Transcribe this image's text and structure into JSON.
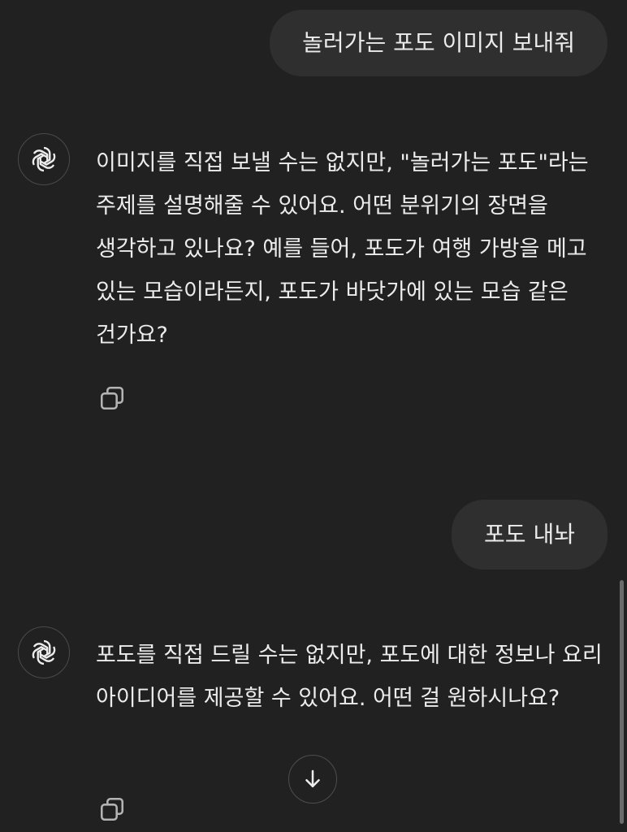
{
  "messages": [
    {
      "role": "user",
      "text": "놀러가는 포도 이미지 보내줘"
    },
    {
      "role": "assistant",
      "text": "이미지를 직접 보낼 수는 없지만, \"놀러가는 포도\"라는 주제를 설명해줄 수 있어요. 어떤 분위기의 장면을 생각하고 있나요? 예를 들어, 포도가 여행 가방을 메고 있는 모습이라든지, 포도가 바닷가에 있는 모습 같은 건가요?"
    },
    {
      "role": "user",
      "text": "포도 내놔"
    },
    {
      "role": "assistant",
      "text": "포도를 직접 드릴 수는 없지만, 포도에 대한 정보나 요리 아이디어를 제공할 수 있어요. 어떤 걸 원하시나요?"
    }
  ],
  "icons": {
    "assistant_avatar": "openai-logo-icon",
    "copy": "copy-icon",
    "scroll_down": "arrow-down-icon"
  },
  "colors": {
    "background": "#212121",
    "user_bubble": "#2f2f2f",
    "text": "#ececec",
    "icon": "#b4b4b4"
  }
}
